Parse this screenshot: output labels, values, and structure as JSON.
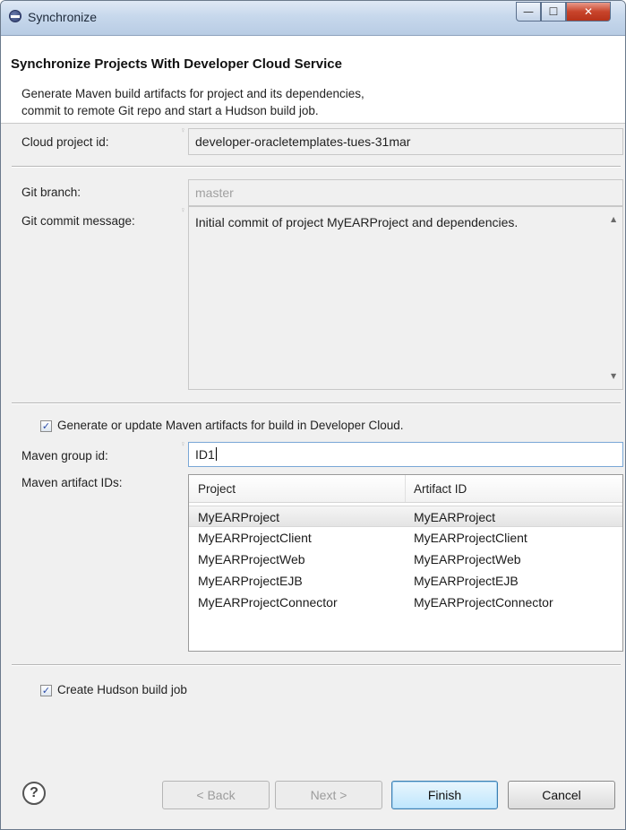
{
  "window": {
    "title": "Synchronize",
    "controls": {
      "minimize": "—",
      "maximize": "☐",
      "close": "✕"
    }
  },
  "header": {
    "title": "Synchronize Projects With Developer Cloud Service",
    "description": "Generate Maven build artifacts for project and its dependencies,\ncommit to remote Git repo and start a Hudson build job."
  },
  "form": {
    "cloud_project_id": {
      "label": "Cloud project id:",
      "value": "developer-oracletemplates-tues-31mar"
    },
    "git_branch": {
      "label": "Git branch:",
      "value": "master"
    },
    "git_commit_message": {
      "label": "Git commit message:",
      "value": "Initial commit of project MyEARProject and dependencies."
    },
    "generate_maven": {
      "label": "Generate or update Maven artifacts for build in Developer Cloud.",
      "checked": true
    },
    "maven_group_id": {
      "label": "Maven group id:",
      "value": "ID1"
    },
    "maven_artifact_ids": {
      "label": "Maven artifact IDs:",
      "columns": [
        "Project",
        "Artifact ID"
      ],
      "rows": [
        [
          "MyEARProject",
          "MyEARProject"
        ],
        [
          "MyEARProjectClient",
          "MyEARProjectClient"
        ],
        [
          "MyEARProjectWeb",
          "MyEARProjectWeb"
        ],
        [
          "MyEARProjectEJB",
          "MyEARProjectEJB"
        ],
        [
          "MyEARProjectConnector",
          "MyEARProjectConnector"
        ]
      ]
    },
    "create_hudson": {
      "label": "Create Hudson build job",
      "checked": true
    }
  },
  "footer": {
    "help_glyph": "?",
    "back_label": "< Back",
    "next_label": "Next >",
    "finish_label": "Finish",
    "cancel_label": "Cancel"
  },
  "icons": {
    "checkmark": "✓",
    "scroll_up": "▲",
    "scroll_down": "▼"
  }
}
